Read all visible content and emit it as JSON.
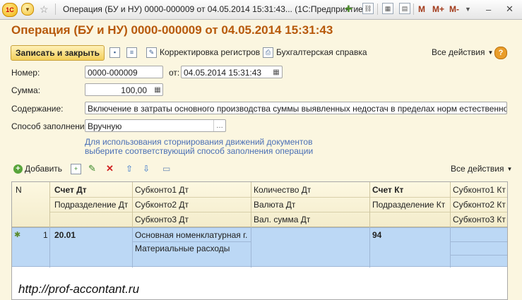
{
  "window": {
    "title": "Операция (БУ и НУ) 0000-000009 от 04.05.2014 15:31:43... (1С:Предприятие)",
    "m": "M",
    "m_plus": "M+",
    "m_minus": "M-",
    "minimize": "–",
    "close": "✕"
  },
  "doc_title": "Операция (БУ и НУ) 0000-000009 от 04.05.2014 15:31:43",
  "toolbar": {
    "save_close": "Записать и закрыть",
    "registers": "Корректировка регистров",
    "accounting_ref": "Бухгалтерская справка",
    "all_actions": "Все действия",
    "help": "?"
  },
  "form": {
    "number_label": "Номер:",
    "number_value": "0000-000009",
    "date_label": "от:",
    "date_value": "04.05.2014 15:31:43",
    "sum_label": "Сумма:",
    "sum_value": "100,00",
    "content_label": "Содержание:",
    "content_value": "Включение в затраты основного производства суммы выявленных недостач в пределах норм естественной убыли",
    "fill_label": "Способ заполнения:",
    "fill_value": "Вручную",
    "hint_line1": "Для использования сторнирования движений документов",
    "hint_line2": "выберите соответствующий способ заполнения операции"
  },
  "table_toolbar": {
    "add": "Добавить",
    "all_actions": "Все действия"
  },
  "table": {
    "headers": {
      "n": "N",
      "acc_dt": "Счет Дт",
      "sub1_dt": "Субконто1 Дт",
      "qty_dt": "Количество Дт",
      "acc_kt": "Счет Кт",
      "sub1_kt": "Субконто1 Кт",
      "dept_dt": "Подразделение Дт",
      "currency_dt": "Валюта Дт",
      "dept_kt": "Подразделение Кт",
      "sub2_kt": "Субконто2 Кт",
      "sub2_dt": "Субконто2 Дт",
      "cur_sum_dt": "Вал. сумма Дт",
      "sub3_kt": "Субконто3 Кт",
      "sub3_dt": "Субконто3 Дт"
    },
    "rows": [
      {
        "n": "1",
        "acc_dt": "20.01",
        "sub1_dt": "Основная номенклатурная г...",
        "sub2_dt": "Материальные расходы",
        "acc_kt": "94"
      }
    ]
  },
  "watermark": "http://prof-accontant.ru"
}
